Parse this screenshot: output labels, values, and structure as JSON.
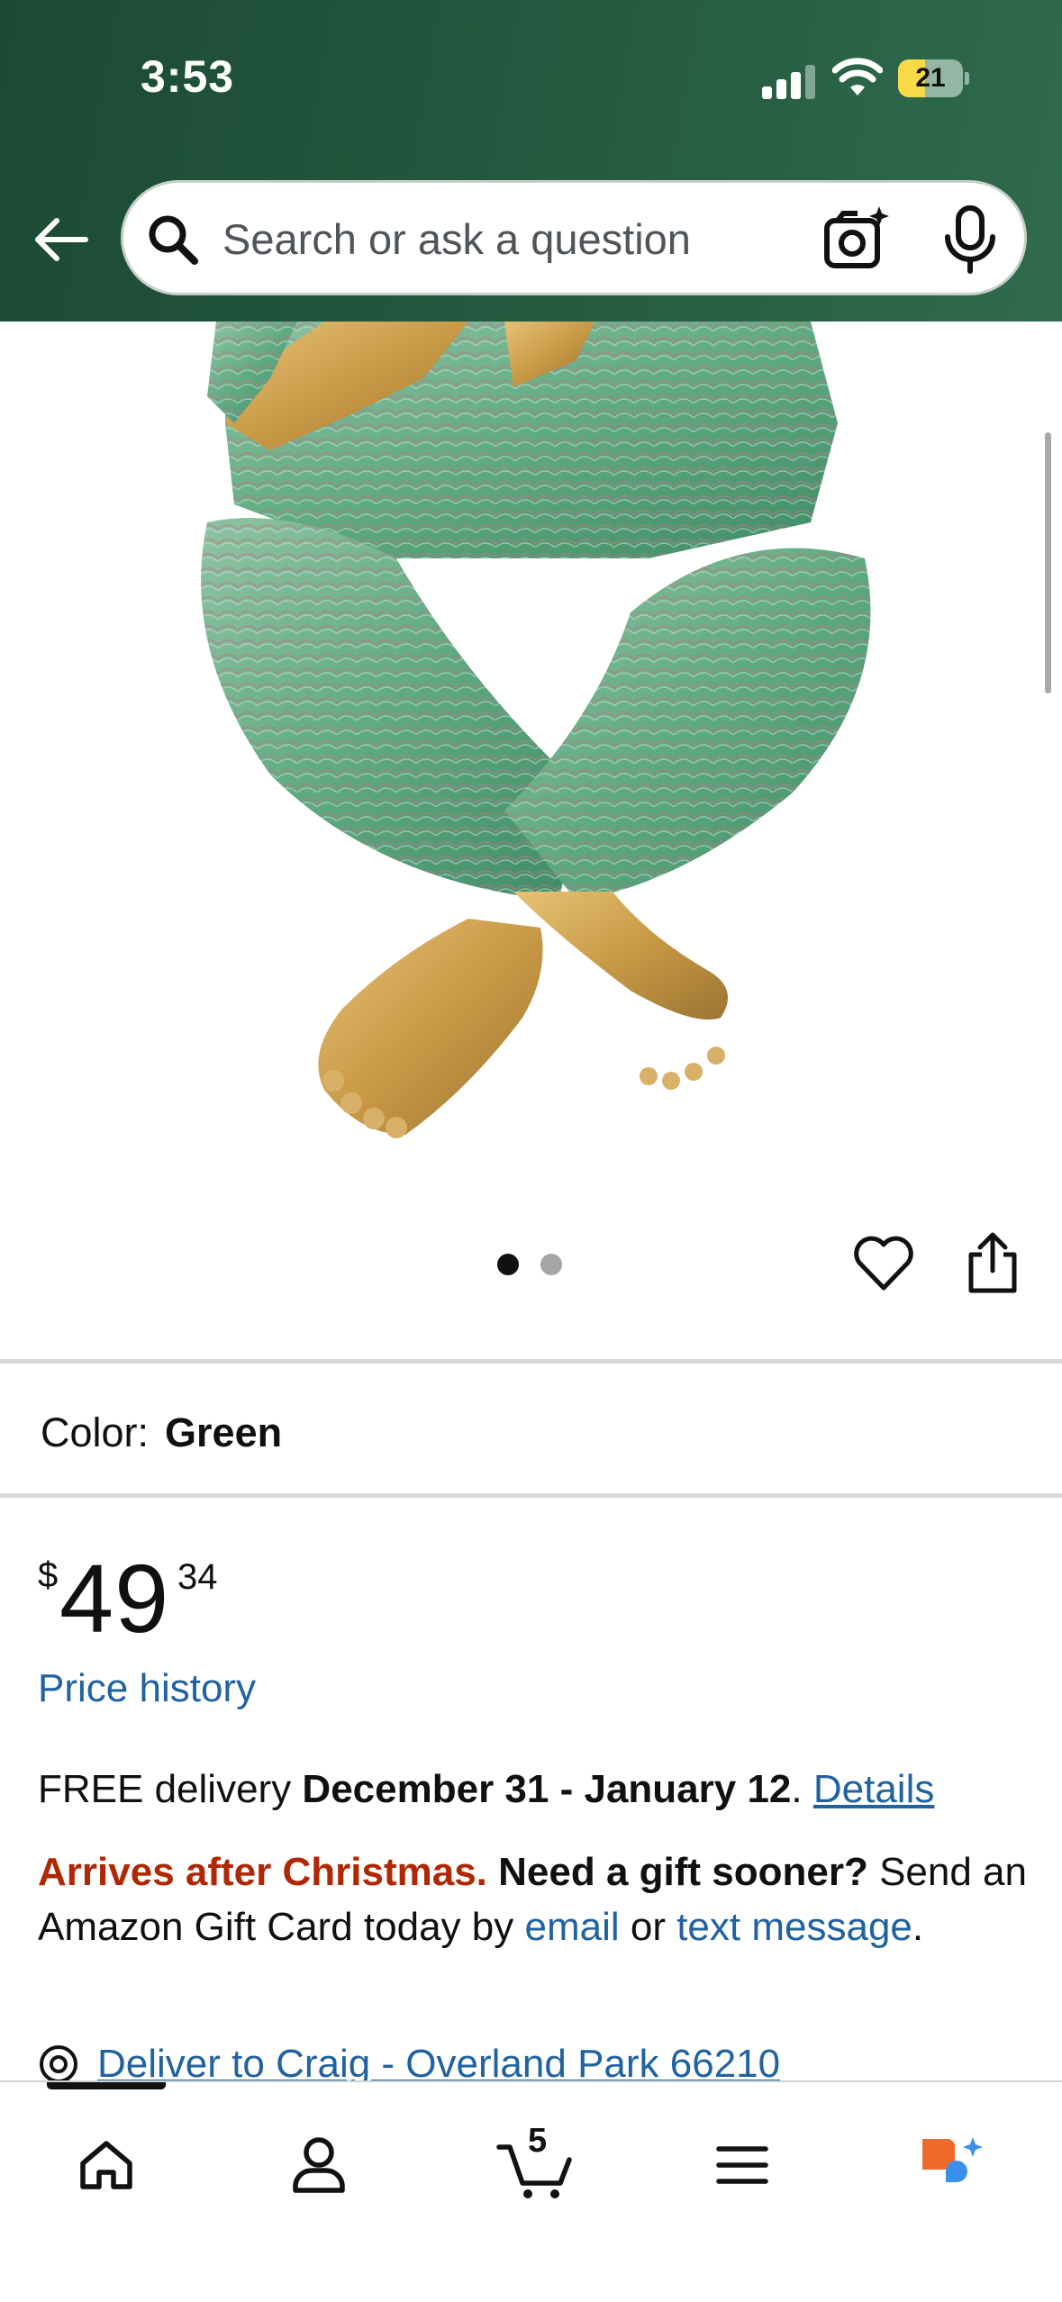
{
  "status_bar": {
    "time": "3:53",
    "battery": "21"
  },
  "search": {
    "placeholder": "Search or ask a question"
  },
  "product": {
    "color_label": "Color:",
    "color_value": "Green",
    "image_count": 2,
    "active_image": 1
  },
  "price": {
    "symbol": "$",
    "whole": "49",
    "fraction": "34",
    "history_link": "Price history"
  },
  "delivery": {
    "prefix": "FREE delivery ",
    "dates": "December 31 - January 12",
    "period": ". ",
    "details_link": "Details"
  },
  "gift_notice": {
    "warning": "Arrives after Christmas.",
    "question": "Need a gift sooner?",
    "text1": " Send an Amazon Gift Card today by ",
    "email_link": "email",
    "text2": " or ",
    "text_link": "text message",
    "end": "."
  },
  "deliver_to": {
    "label": "Deliver to Craig - Overland Park 66210"
  },
  "tabbar": {
    "cart_count": "5",
    "tabs": [
      "home-icon",
      "profile-icon",
      "cart-icon",
      "menu-icon",
      "rufus-icon"
    ]
  },
  "colors": {
    "header_green": "#24573f",
    "link_blue": "#2162a1",
    "warning_red": "#b12704",
    "rufus_orange": "#ef6a2a",
    "rufus_blue": "#3a8fe8"
  }
}
